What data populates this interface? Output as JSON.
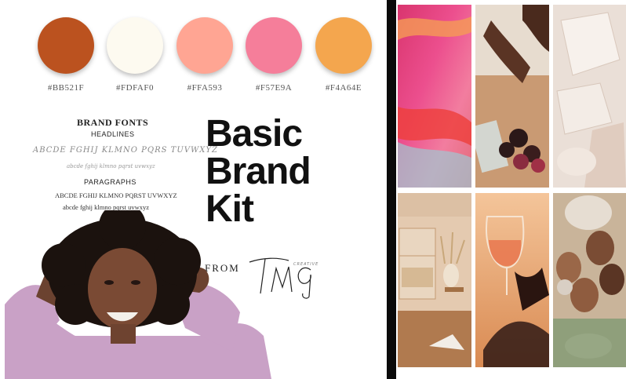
{
  "palette": {
    "swatches": [
      {
        "color": "#BB521F",
        "label": "#BB521F"
      },
      {
        "color": "#FDFAF0",
        "label": "#FDFAF0"
      },
      {
        "color": "#FFA593",
        "label": "#FFA593"
      },
      {
        "color": "#F57E9A",
        "label": "#F57E9A"
      },
      {
        "color": "#F4A64E",
        "label": "#F4A64E"
      }
    ]
  },
  "fonts": {
    "title": "BRAND FONTS",
    "headlines_label": "HEADLINES",
    "script_sample": "ABCDE FGHIJ KLMNO PQRS TUVWXYZ",
    "script_lower": "abcde fghij klmno pqrst uvwxyz",
    "paragraphs_label": "PARAGRAPHS",
    "serif_upper": "ABCDE FGHIJ KLMNO PQRST UVWXYZ",
    "serif_lower": "abcde fghij klmno pqrst uvwxyz"
  },
  "hero": {
    "line1": "Basic",
    "line2": "Brand",
    "line3": "Kit",
    "from": "FROM",
    "signature": "TMG"
  },
  "icons": {
    "portrait": "woman-portrait-photo",
    "photos": [
      "abstract-pink-photo",
      "figs-hands-photo",
      "ice-glass-photo",
      "interior-vase-photo",
      "wine-toast-photo",
      "women-group-photo"
    ]
  }
}
